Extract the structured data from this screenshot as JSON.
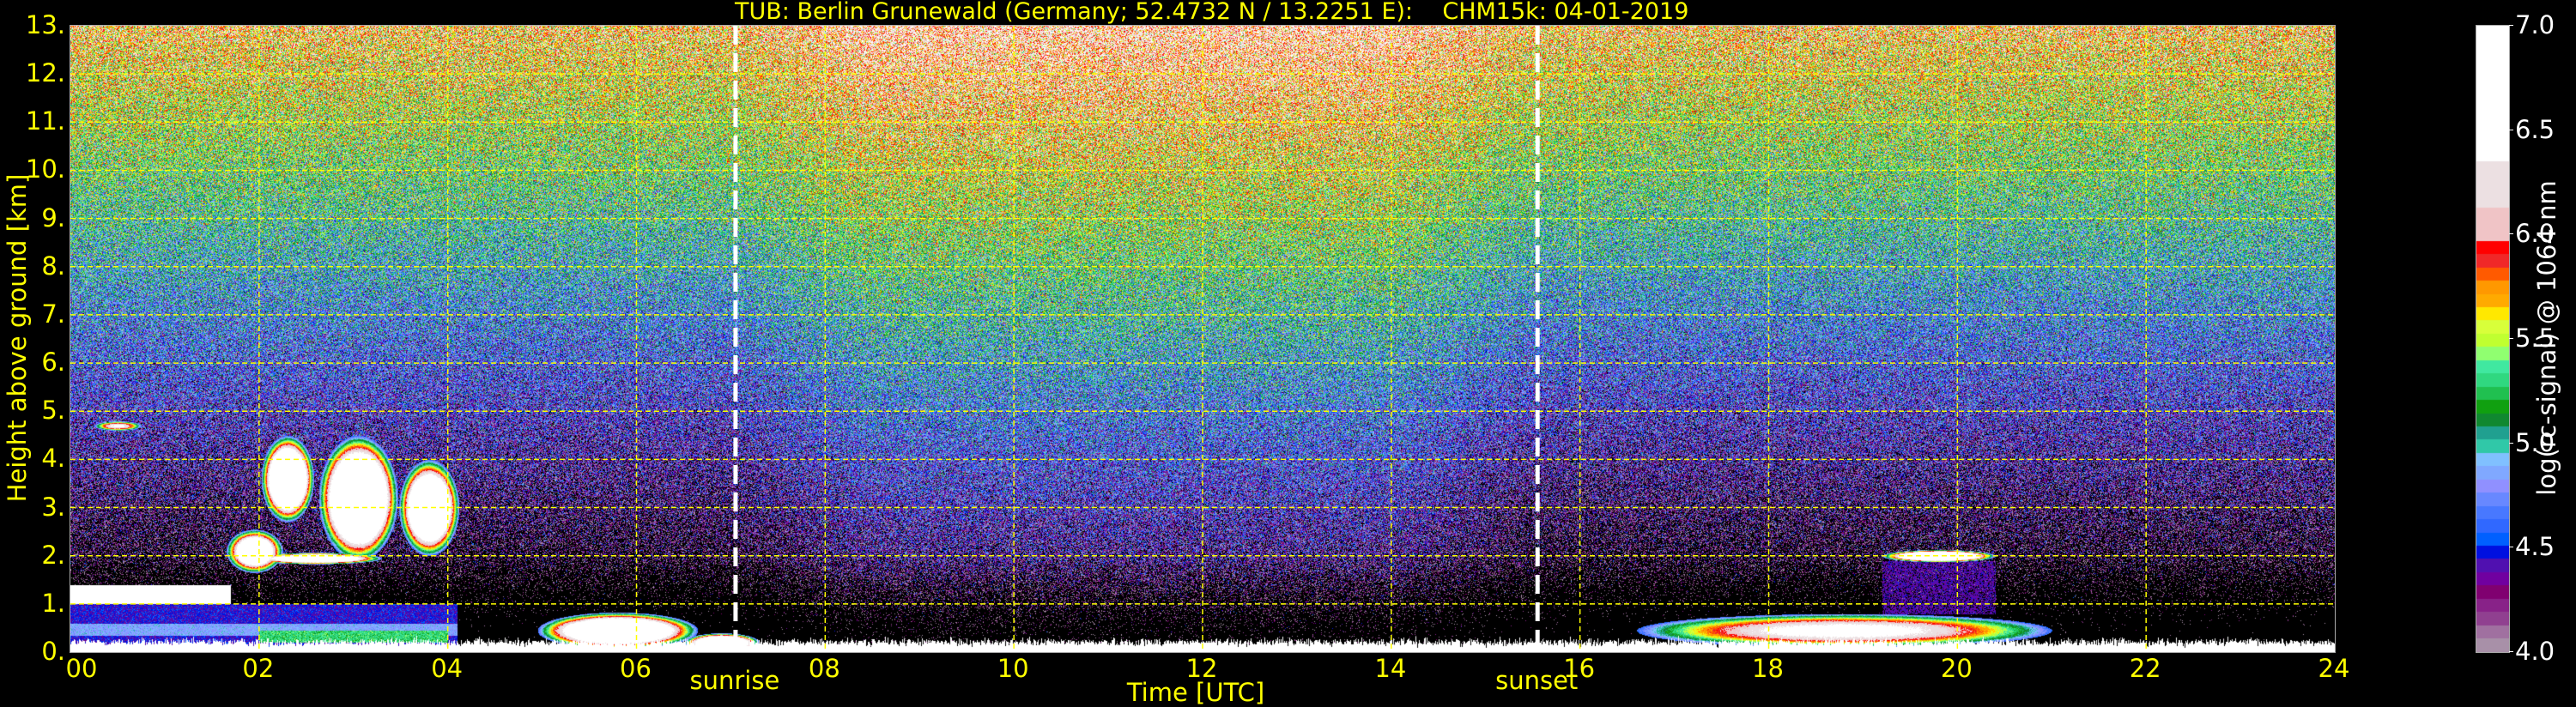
{
  "chart_data": {
    "type": "heatmap",
    "title": "TUB: Berlin Grunewald (Germany; 52.4732 N / 13.2251 E):    CHM15k: 04-01-2019",
    "xlabel": "Time [UTC]",
    "ylabel": "Height above ground [km]",
    "xlim": [
      0,
      24
    ],
    "ylim": [
      0,
      13
    ],
    "x_ticks": [
      0,
      2,
      4,
      6,
      8,
      10,
      12,
      14,
      16,
      18,
      20,
      22,
      24
    ],
    "x_tick_labels": [
      "00",
      "02",
      "04",
      "06",
      "08",
      "10",
      "12",
      "14",
      "16",
      "18",
      "20",
      "22",
      "24"
    ],
    "y_ticks": [
      0,
      1,
      2,
      3,
      4,
      5,
      6,
      7,
      8,
      9,
      10,
      11,
      12,
      13
    ],
    "y_tick_labels": [
      "0.",
      "1.",
      "2.",
      "3.",
      "4.",
      "5.",
      "6.",
      "7.",
      "8.",
      "9.",
      "10.",
      "11.",
      "12.",
      "13."
    ],
    "grid": true,
    "grid_color": "#ffff00",
    "annotations": [
      {
        "label": "sunrise",
        "x": 7.05
      },
      {
        "label": "sunset",
        "x": 15.55
      }
    ],
    "colorbar": {
      "label": "log(rc-signal) @ 1064 nm",
      "range": [
        4.0,
        7.0
      ],
      "ticks": [
        4.0,
        4.5,
        5.0,
        5.5,
        6.0,
        6.5,
        7.0
      ],
      "tick_labels": [
        "4.0",
        "4.5",
        "5.0",
        "5.5",
        "6.0",
        "6.5",
        "7.0"
      ],
      "colors_low_to_high": [
        "#a890a8",
        "#a070a0",
        "#904090",
        "#882288",
        "#800070",
        "#7000a0",
        "#5010b0",
        "#0010e0",
        "#0060ff",
        "#3068ff",
        "#4878ff",
        "#6888ff",
        "#9090ff",
        "#80a8ff",
        "#80c0ff",
        "#30c8a8",
        "#20a090",
        "#108830",
        "#10a010",
        "#20c050",
        "#30d880",
        "#40e8a0",
        "#90ff70",
        "#c0ff30",
        "#d8ff3a",
        "#ffe800",
        "#ffaa00",
        "#ff9800",
        "#ff5a00",
        "#f02828",
        "#ff0000",
        "#f0c4c6",
        "#ece0e2",
        "#ffffff"
      ],
      "band_upper_bounds_top3": [
        6.13,
        6.35,
        7.0
      ]
    },
    "features": [
      {
        "kind": "surface-layer",
        "x": [
          0,
          24
        ],
        "y": [
          0,
          0.25
        ]
      },
      {
        "kind": "aerosol-layer",
        "x": [
          0,
          4.1
        ],
        "y": [
          0,
          1.0
        ]
      },
      {
        "kind": "cloud",
        "x": [
          1.6,
          4.1
        ],
        "y": [
          1.5,
          4.5
        ]
      },
      {
        "kind": "aerosol-layer",
        "x": [
          4.9,
          6.6
        ],
        "y": [
          0,
          0.8
        ]
      },
      {
        "kind": "aerosol-layer",
        "x": [
          16.2,
          20.8
        ],
        "y": [
          0.1,
          0.8
        ]
      },
      {
        "kind": "cloud",
        "x": [
          19.2,
          20.4
        ],
        "y": [
          1.85,
          2.15
        ]
      }
    ]
  }
}
